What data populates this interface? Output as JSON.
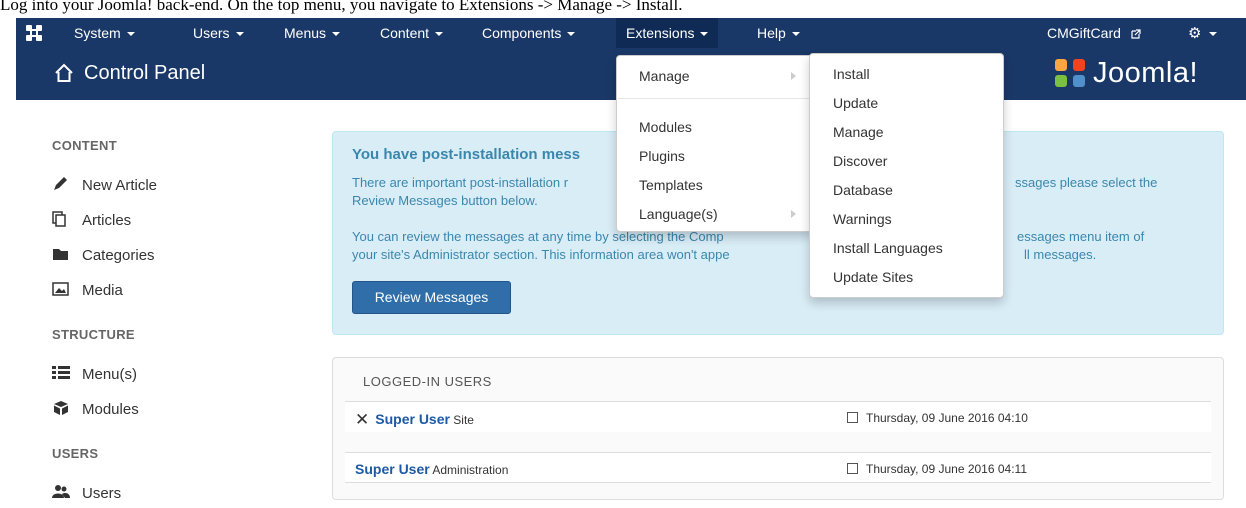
{
  "caption": "Log into your Joomla! back-end. On the top menu, you navigate to Extensions -> Manage -> Install.",
  "topbar": {
    "menus": [
      {
        "label": "System"
      },
      {
        "label": "Users"
      },
      {
        "label": "Menus"
      },
      {
        "label": "Content"
      },
      {
        "label": "Components"
      },
      {
        "label": "Extensions"
      },
      {
        "label": "Help"
      }
    ],
    "site_link": "CMGiftCard",
    "settings_icon": "gear-icon"
  },
  "header": {
    "title": "Control Panel",
    "logo_text": "Joomla!"
  },
  "extensions_menu": {
    "items": [
      "Manage",
      "Modules",
      "Plugins",
      "Templates",
      "Language(s)"
    ]
  },
  "manage_submenu": {
    "items": [
      "Install",
      "Update",
      "Manage",
      "Discover",
      "Database",
      "Warnings",
      "Install Languages",
      "Update Sites"
    ]
  },
  "sidebar": {
    "content_header": "CONTENT",
    "content_items": [
      {
        "label": "New Article",
        "icon": "pencil-icon"
      },
      {
        "label": "Articles",
        "icon": "stack-icon"
      },
      {
        "label": "Categories",
        "icon": "folder-icon"
      },
      {
        "label": "Media",
        "icon": "image-icon"
      }
    ],
    "structure_header": "STRUCTURE",
    "structure_items": [
      {
        "label": "Menu(s)",
        "icon": "list-icon"
      },
      {
        "label": "Modules",
        "icon": "cube-icon"
      }
    ],
    "users_header": "USERS",
    "users_items": [
      {
        "label": "Users",
        "icon": "users-icon"
      }
    ]
  },
  "alert": {
    "heading": "You have post-installation mess",
    "line1_left": "There are important post-installation r",
    "line1_right": "ssages please select the",
    "line2": "Review Messages button below.",
    "line3_left": "You can review the messages at any time by selecting the Comp",
    "line3_right": "essages menu item of",
    "line4_left": "your site's Administrator section. This information area won't appe",
    "line4_right": "ll messages.",
    "button": "Review Messages"
  },
  "logged_in": {
    "title": "LOGGED-IN USERS",
    "rows": [
      {
        "user": "Super User",
        "where": "Site",
        "date": "Thursday, 09 June 2016 04:10"
      },
      {
        "user": "Super User",
        "where": "Administration",
        "date": "Thursday, 09 June 2016 04:11"
      }
    ]
  },
  "colors": {
    "navbar": "#1a3867",
    "alert_bg": "#d9edf7",
    "alert_text": "#3a87ad",
    "primary_button": "#2f6ea8",
    "link": "#1c5aa6"
  }
}
